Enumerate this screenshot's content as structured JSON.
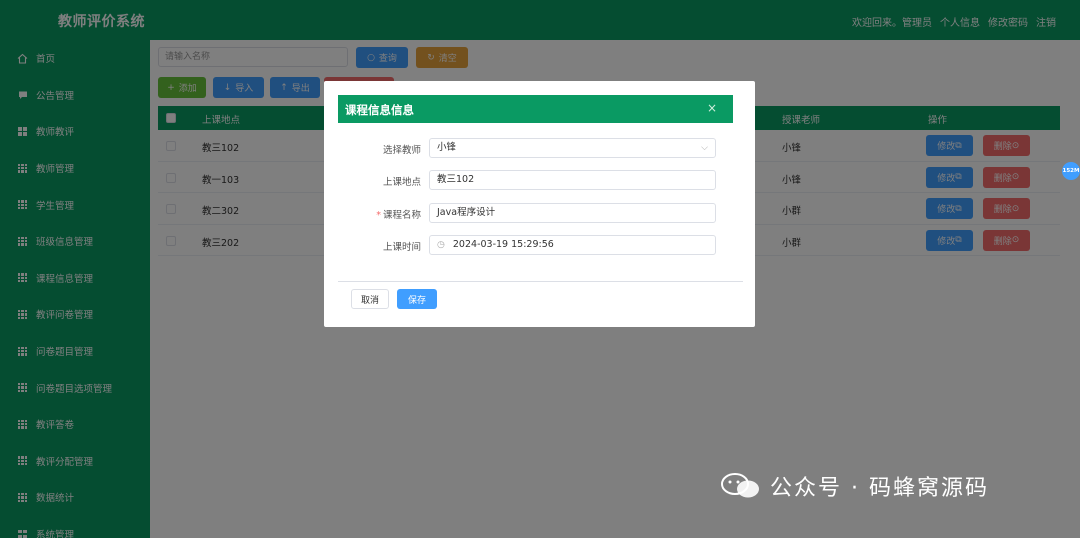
{
  "header": {
    "title": "教师评价系统",
    "welcome": "欢迎回来。管理员",
    "links": [
      "个人信息",
      "修改密码",
      "注销"
    ]
  },
  "sidebar": {
    "items": [
      {
        "label": "首页",
        "icon": "home-icon"
      },
      {
        "label": "公告管理",
        "icon": "message-icon"
      },
      {
        "label": "教师教评",
        "icon": "grid-icon"
      },
      {
        "label": "教师管理",
        "icon": "grid-icon"
      },
      {
        "label": "学生管理",
        "icon": "grid-icon"
      },
      {
        "label": "班级信息管理",
        "icon": "grid-icon"
      },
      {
        "label": "课程信息管理",
        "icon": "grid-icon"
      },
      {
        "label": "教评问卷管理",
        "icon": "grid-icon"
      },
      {
        "label": "问卷题目管理",
        "icon": "grid-icon"
      },
      {
        "label": "问卷题目选项管理",
        "icon": "grid-icon"
      },
      {
        "label": "教评答卷",
        "icon": "grid-icon"
      },
      {
        "label": "教评分配管理",
        "icon": "grid-icon"
      },
      {
        "label": "数据统计",
        "icon": "grid-icon"
      },
      {
        "label": "系统管理",
        "icon": "grid-icon"
      }
    ]
  },
  "toolbar": {
    "search_placeholder": "请输入名称",
    "query_label": "查询",
    "reset_label": "清空",
    "add_label": "添加",
    "import_label": "导入",
    "export_label": "导出"
  },
  "table": {
    "headers": {
      "location": "上课地点",
      "teacher": "授课老师",
      "action": "操作"
    },
    "edit_label": "修改",
    "delete_label": "删除",
    "rows": [
      {
        "location": "教三102",
        "teacher": "小锋"
      },
      {
        "location": "教一103",
        "teacher": "小锋"
      },
      {
        "location": "教二302",
        "teacher": "小群"
      },
      {
        "location": "教三202",
        "teacher": "小群"
      }
    ]
  },
  "dialog": {
    "title": "课程信息信息",
    "close": "×",
    "fields": [
      {
        "label": "选择教师",
        "value": "小锋",
        "required": false,
        "type": "select"
      },
      {
        "label": "上课地点",
        "value": "教三102",
        "required": false,
        "type": "text"
      },
      {
        "label": "课程名称",
        "value": "Java程序设计",
        "required": true,
        "type": "text"
      },
      {
        "label": "上课时间",
        "value": "2024-03-19 15:29:56",
        "required": false,
        "type": "datetime"
      }
    ],
    "cancel_label": "取消",
    "save_label": "保存"
  },
  "float_badge": "152M",
  "watermark": "公众号 · 码蜂窝源码",
  "colors": {
    "primary": "#0a9a63",
    "blue": "#409eff",
    "orange": "#e6a23c",
    "green": "#67c23a",
    "red": "#f56c6c"
  }
}
